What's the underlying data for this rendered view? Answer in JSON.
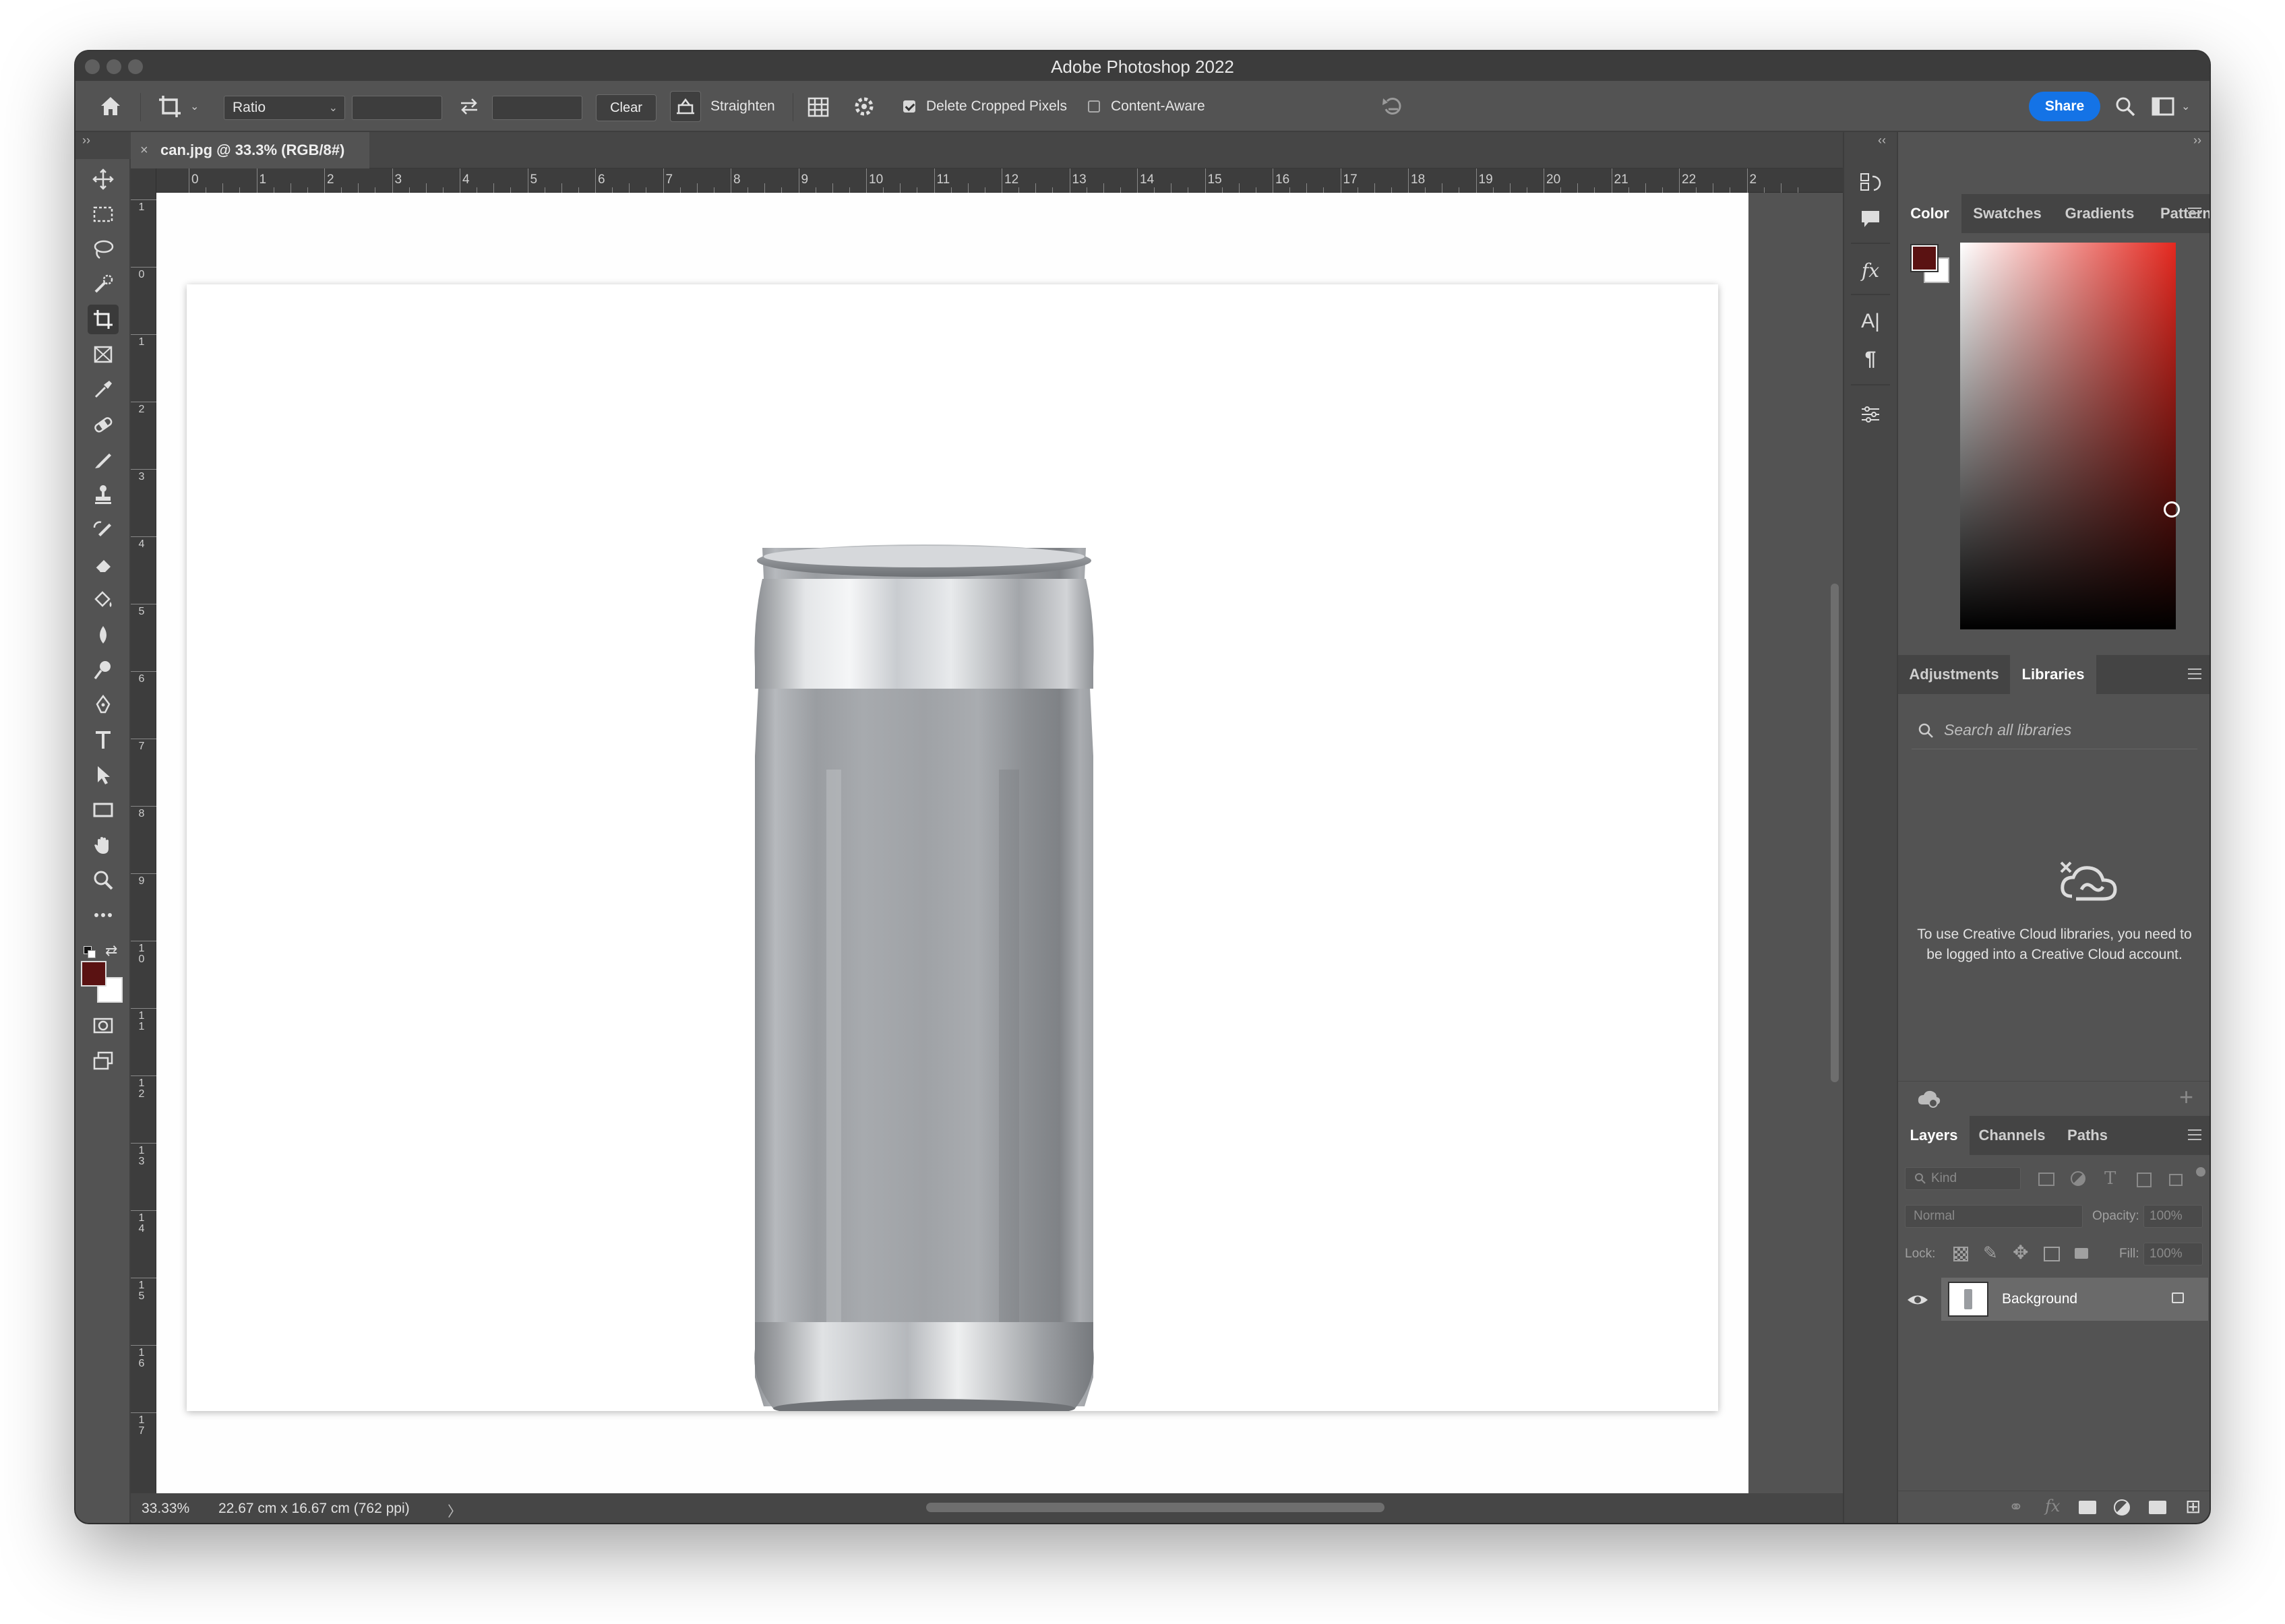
{
  "window": {
    "title": "Adobe Photoshop 2022"
  },
  "options_bar": {
    "ratio_select": "Ratio",
    "clear_label": "Clear",
    "straighten_label": "Straighten",
    "delete_cropped_label": "Delete Cropped Pixels",
    "delete_cropped_checked": true,
    "content_aware_label": "Content-Aware",
    "content_aware_checked": false,
    "share_label": "Share"
  },
  "document": {
    "tab_label": "can.jpg @ 33.3% (RGB/8#)",
    "close_symbol": "×",
    "zoom": "33.33%",
    "dimensions": "22.67 cm x 16.67 cm (762 ppi)",
    "status_chevron": "〉"
  },
  "rulers": {
    "horizontal": [
      "0",
      "1",
      "2",
      "3",
      "4",
      "5",
      "6",
      "7",
      "8",
      "9",
      "10",
      "11",
      "12",
      "13",
      "14",
      "15",
      "16",
      "17",
      "18",
      "19",
      "20",
      "21",
      "22",
      "2"
    ],
    "vertical": [
      "1",
      "0",
      "1",
      "2",
      "3",
      "4",
      "5",
      "6",
      "7",
      "8",
      "9",
      "10",
      "11",
      "12",
      "13",
      "14",
      "15",
      "16",
      "17"
    ]
  },
  "tools": [
    "move-tool",
    "marquee-tool",
    "lasso-tool",
    "quick-select-tool",
    "crop-tool",
    "frame-tool",
    "eyedropper-tool",
    "healing-brush-tool",
    "brush-tool",
    "clone-stamp-tool",
    "history-brush-tool",
    "eraser-tool",
    "paint-bucket-tool",
    "blur-tool",
    "dodge-tool",
    "pen-tool",
    "type-tool",
    "path-select-tool",
    "rectangle-tool",
    "hand-tool",
    "zoom-tool",
    "more-tools"
  ],
  "colors": {
    "foreground": "#5a1212",
    "background": "#ffffff",
    "accent": "#1473e6",
    "hue_pick": "#e4281f"
  },
  "color_panel": {
    "tabs": [
      "Color",
      "Swatches",
      "Gradients",
      "Patterns"
    ],
    "active": "Color"
  },
  "libraries_panel": {
    "tabs": [
      "Adjustments",
      "Libraries"
    ],
    "active": "Libraries",
    "search_placeholder": "Search all libraries",
    "message": "To use Creative Cloud libraries, you need to be logged into a Creative Cloud account."
  },
  "layers_panel": {
    "tabs": [
      "Layers",
      "Channels",
      "Paths"
    ],
    "active": "Layers",
    "filter_kind": "Kind",
    "blend_mode": "Normal",
    "opacity_label": "Opacity:",
    "opacity_value": "100%",
    "lock_label": "Lock:",
    "fill_label": "Fill:",
    "fill_value": "100%",
    "layers": [
      {
        "name": "Background",
        "visible": true,
        "locked": true
      }
    ]
  },
  "panel_strip_text": {
    "fx": "fx",
    "type": "A|",
    "paragraph": "¶"
  }
}
